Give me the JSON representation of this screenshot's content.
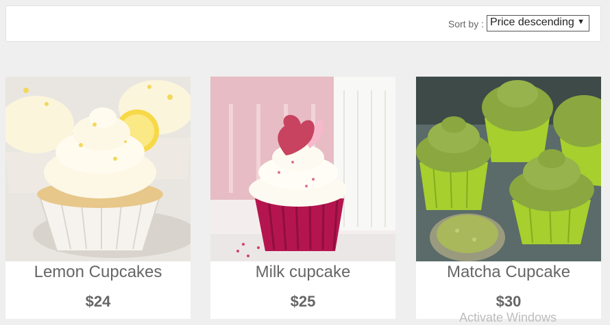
{
  "toolbar": {
    "sort_label": "Sort by :",
    "sort_value": "Price descending"
  },
  "products": [
    {
      "name": "Lemon Cupcakes",
      "price": "$24"
    },
    {
      "name": "Milk cupcake",
      "price": "$25"
    },
    {
      "name": "Matcha Cupcake",
      "price": "$30"
    }
  ],
  "overlay": {
    "watermark": "Activate Windows"
  },
  "colors": {
    "background": "#efefef",
    "card": "#ffffff",
    "text": "#666666",
    "matcha_green": "#8aa83f",
    "milk_pink": "#b5154f"
  }
}
